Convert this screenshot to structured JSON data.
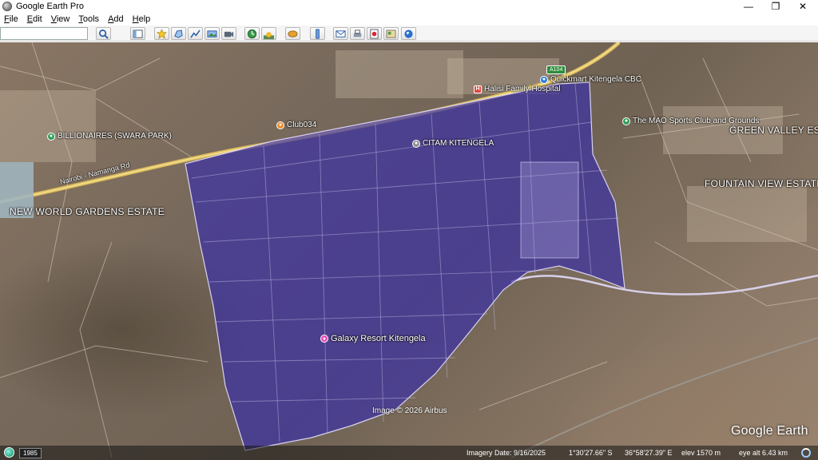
{
  "window": {
    "title": "Google Earth Pro",
    "controls": {
      "minimize": "—",
      "maximize": "❐",
      "close": "✕"
    }
  },
  "menu": [
    "File",
    "Edit",
    "View",
    "Tools",
    "Add",
    "Help"
  ],
  "search": {
    "value": "",
    "placeholder": ""
  },
  "toolbar": {
    "buttons": [
      "search-icon",
      "sidebar-icon",
      "placemark-icon",
      "polygon-icon",
      "path-icon",
      "image-overlay-icon",
      "record-tour-icon",
      "historical-imagery-icon",
      "sunlight-icon",
      "planets-icon",
      "ruler-icon",
      "email-icon",
      "print-icon",
      "save-image-icon",
      "view-in-maps-icon",
      "earth-icon"
    ]
  },
  "map": {
    "place_labels": [
      {
        "id": "new-world-gardens",
        "text": "NEW WORLD GARDENS ESTATE"
      },
      {
        "id": "green-valley",
        "text": "GREEN VALLEY ESTA"
      },
      {
        "id": "fountain-view",
        "text": "FOUNTAIN VIEW ESTATES"
      }
    ],
    "pois": [
      {
        "id": "billionaires",
        "text": "BILLIONAIRES (SWARA PARK)",
        "color": "#2e9d57"
      },
      {
        "id": "club034",
        "text": "Club034",
        "color": "#f08a2a"
      },
      {
        "id": "halisi",
        "text": "Halisi Family Hospital",
        "color": "#e0443c"
      },
      {
        "id": "quickmart",
        "text": "Quickmart Kitengela CBC",
        "color": "#2b7de0"
      },
      {
        "id": "mao",
        "text": "The MAO Sports Club and Grounds",
        "color": "#2e9d57"
      },
      {
        "id": "citam",
        "text": "CITAM KITENGELA",
        "color": "#8f8f8f"
      },
      {
        "id": "galaxy",
        "text": "Galaxy Resort Kitengela",
        "color": "#e64bb0"
      }
    ],
    "road_labels": {
      "shield": "A104",
      "road_name": "Nairobi - Namanga Rd"
    },
    "overlay_color": "#3a2fa8",
    "attribution": "Image © 2026 Airbus",
    "watermark": "Google Earth"
  },
  "status": {
    "year": "1985",
    "imagery_date": "Imagery Date: 9/16/2025",
    "lat": "1°30'27.66\" S",
    "lon": "36°58'27.39\" E",
    "elev": "elev  1570 m",
    "eye_alt": "eye alt   6.43 km"
  }
}
